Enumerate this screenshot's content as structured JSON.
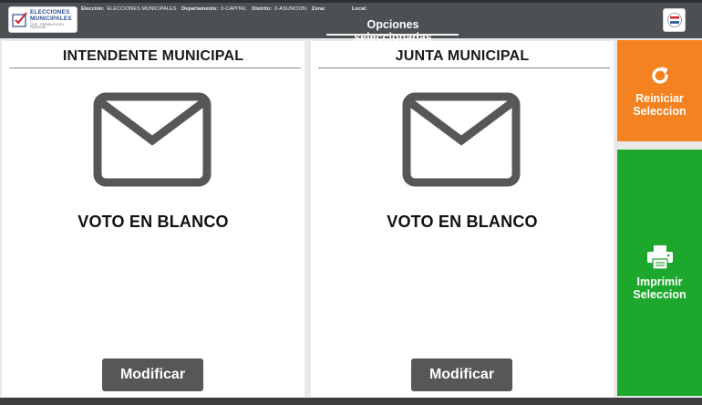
{
  "header": {
    "logo": {
      "line1": "ELECCIONES",
      "line2": "MUNICIPALES",
      "line3": "TSJE · REPÚBLICA DEL PARAGUAY"
    },
    "info": {
      "eleccion_label": "Elección:",
      "eleccion_value": "ELECCIONES MUNICIPALES",
      "departamento_label": "Departamento:",
      "departamento_value": "0-CAPITAL",
      "distrito_label": "Distrito:",
      "distrito_value": "0-ASUNCION",
      "zona_label": "Zona:",
      "zona_value": "",
      "local_label": "Local:",
      "local_value": ""
    },
    "title": "Opciones seleccionadas"
  },
  "panels": [
    {
      "title": "INTENDENTE MUNICIPAL",
      "vote_label": "VOTO EN BLANCO",
      "icon": "envelope-icon",
      "button": "Modificar"
    },
    {
      "title": "JUNTA MUNICIPAL",
      "vote_label": "VOTO EN BLANCO",
      "icon": "envelope-icon",
      "button": "Modificar"
    }
  ],
  "actions": {
    "reset": {
      "line1": "Reiniciar",
      "line2": "Seleccion",
      "icon": "refresh-icon",
      "color": "#f58220"
    },
    "print": {
      "line1": "Imprimir",
      "line2": "Seleccion",
      "icon": "printer-icon",
      "color": "#1ea72d"
    }
  },
  "colors": {
    "header_bg": "#4d5052",
    "button_gray": "#555758",
    "icon_gray": "#555758"
  }
}
